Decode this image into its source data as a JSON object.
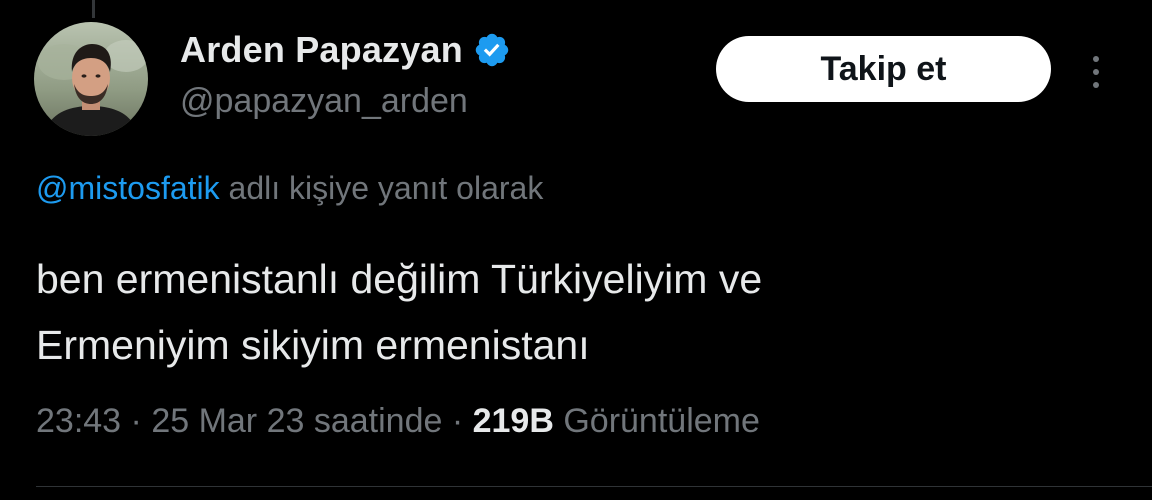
{
  "tweet": {
    "author": {
      "display_name": "Arden Papazyan",
      "handle": "@papazyan_arden",
      "verified_icon": "verified-badge-icon",
      "avatar_icon": "avatar-photo"
    },
    "follow_label": "Takip et",
    "more_icon": "more-options-icon",
    "reply_context": {
      "mention": "@mistosfatik",
      "suffix": " adlı kişiye yanıt olarak"
    },
    "text_lines": [
      "ben ermenistanlı değilim Türkiyeliyim ve",
      "Ermeniyim sikiyim ermenistanı"
    ],
    "meta": {
      "time": "23:43",
      "separator": " · ",
      "date": "25 Mar 23 saatinde",
      "views_count": "219B",
      "views_label": " Görüntüleme"
    }
  },
  "colors": {
    "background": "#000000",
    "primary_text": "#e7e9ea",
    "secondary_text": "#71767b",
    "link": "#1d9bf0",
    "verified": "#1d9bf0",
    "follow_button_bg": "#ffffff",
    "follow_button_text": "#0f1419"
  }
}
